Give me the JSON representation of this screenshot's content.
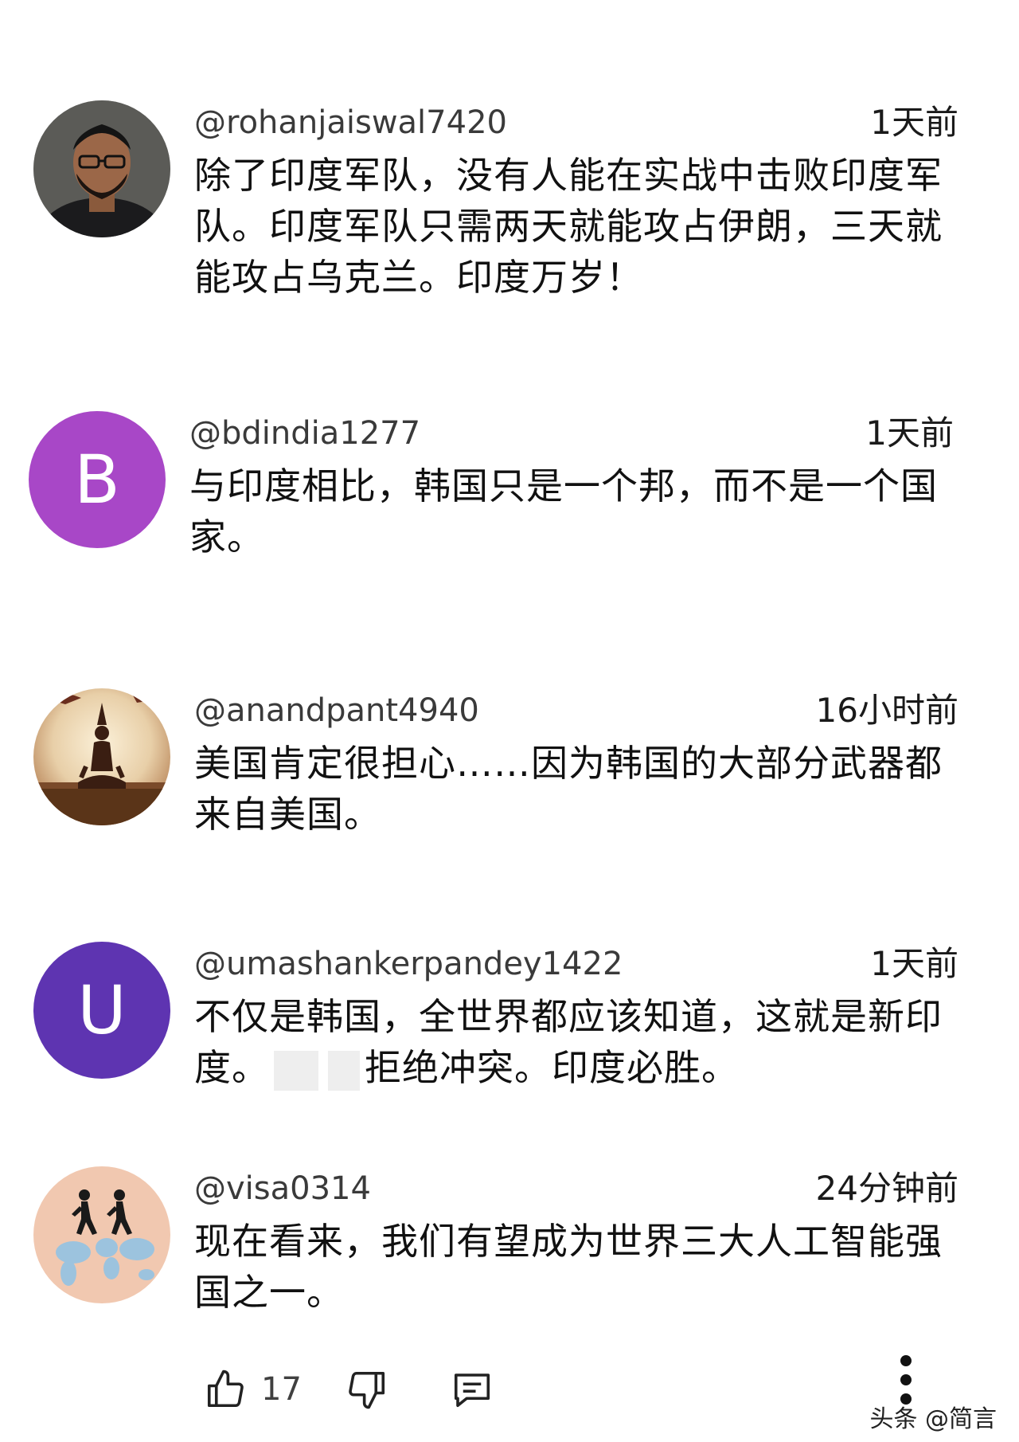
{
  "comments": [
    {
      "username": "@rohanjaiswal7420",
      "time": "1天前",
      "text": "除了印度军队，没有人能在实战中击败印度军队。印度军队只需两天就能攻占伊朗，三天就能攻占乌克兰。印度万岁！",
      "avatar": "photo-man-glasses-icon"
    },
    {
      "username": "@bdindia1277",
      "time": "1天前",
      "text": "与印度相比，韩国只是一个邦，而不是一个国家。",
      "avatar_letter": "B",
      "avatar_color": "#a847c7"
    },
    {
      "username": "@anandpant4940",
      "time": "16小时前",
      "text": "美国肯定很担心……因为韩国的大部分武器都来自美国。",
      "avatar": "yoga-silhouette-icon"
    },
    {
      "username": "@umashankerpandey1422",
      "time": "1天前",
      "text_a": "不仅是韩国，全世界都应该知道，这就是新印度。",
      "text_b": "拒绝冲突。印度必胜。",
      "avatar_letter": "U",
      "avatar_color": "#5e34b1"
    },
    {
      "username": "@visa0314",
      "time": "24分钟前",
      "text": "现在看来，我们有望成为世界三大人工智能强国之一。",
      "avatar": "world-map-walkers-icon"
    }
  ],
  "actions": {
    "like_count": "17"
  },
  "watermark": "头条 @简言"
}
